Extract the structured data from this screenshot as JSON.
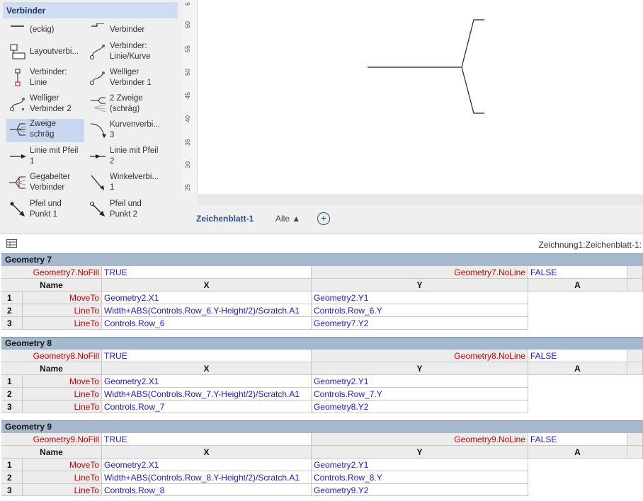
{
  "stencil": {
    "title": "Verbinder",
    "items": [
      {
        "label": "(eckig)"
      },
      {
        "label": "Verbinder"
      },
      {
        "label": "Layoutverbi..."
      },
      {
        "label": "Verbinder:\nLinie/Kurve"
      },
      {
        "label": "Verbinder:\nLinie"
      },
      {
        "label": "Welliger\nVerbinder 1"
      },
      {
        "label": "Welliger\nVerbinder 2"
      },
      {
        "label": "2 Zweige\n(schräg)"
      },
      {
        "label": "Zweige\nschräg"
      },
      {
        "label": "Kurvenverbi...\n3"
      },
      {
        "label": "Linie mit Pfeil\n1"
      },
      {
        "label": "Linie mit Pfeil\n2"
      },
      {
        "label": "Gegabelter\nVerbinder"
      },
      {
        "label": "Winkelverbi...\n1"
      },
      {
        "label": "Pfeil und\nPunkt 1"
      },
      {
        "label": "Pfeil und\nPunkt 2"
      }
    ]
  },
  "ruler": {
    "ticks": [
      "6",
      "60",
      "55",
      "50",
      "45",
      "40",
      "35",
      "30",
      "25"
    ]
  },
  "tabs": {
    "active": "Zeichenblatt-1",
    "all": "Alle ▲",
    "add": "+"
  },
  "sheet": {
    "path": "Zeichnung1:Zeichenblatt-1:",
    "col_name": "Name",
    "col_x": "X",
    "col_y": "Y",
    "col_a": "A",
    "sections": [
      {
        "title": "Geometry 7",
        "nofill_name": "Geometry7.NoFill",
        "nofill_value": "TRUE",
        "noline_name": "Geometry7.NoLine",
        "noline_value": "FALSE",
        "rows": [
          {
            "n": "1",
            "name": "MoveTo",
            "x": "Geometry2.X1",
            "y": "Geometry2.Y1"
          },
          {
            "n": "2",
            "name": "LineTo",
            "x": "Width+ABS(Controls.Row_6.Y-Height/2)/Scratch.A1",
            "y": "Controls.Row_6.Y"
          },
          {
            "n": "3",
            "name": "LineTo",
            "x": "Controls.Row_6",
            "y": "Geometry7.Y2"
          }
        ]
      },
      {
        "title": "Geometry 8",
        "nofill_name": "Geometry8.NoFill",
        "nofill_value": "TRUE",
        "noline_name": "Geometry8.NoLine",
        "noline_value": "FALSE",
        "rows": [
          {
            "n": "1",
            "name": "MoveTo",
            "x": "Geometry2.X1",
            "y": "Geometry2.Y1"
          },
          {
            "n": "2",
            "name": "LineTo",
            "x": "Width+ABS(Controls.Row_7.Y-Height/2)/Scratch.A1",
            "y": "Controls.Row_7.Y"
          },
          {
            "n": "3",
            "name": "LineTo",
            "x": "Controls.Row_7",
            "y": "Geometry8.Y2"
          }
        ]
      },
      {
        "title": "Geometry 9",
        "nofill_name": "Geometry9.NoFill",
        "nofill_value": "TRUE",
        "noline_name": "Geometry9.NoLine",
        "noline_value": "FALSE",
        "rows": [
          {
            "n": "1",
            "name": "MoveTo",
            "x": "Geometry2.X1",
            "y": "Geometry2.Y1"
          },
          {
            "n": "2",
            "name": "LineTo",
            "x": "Width+ABS(Controls.Row_8.Y-Height/2)/Scratch.A1",
            "y": "Controls.Row_8.Y"
          },
          {
            "n": "3",
            "name": "LineTo",
            "x": "Controls.Row_8",
            "y": "Geometry9.Y2"
          }
        ]
      }
    ]
  },
  "colors": {
    "accent": "#2b4f8a",
    "formula_name": "#d00000",
    "formula_value": "#1a1ad6",
    "section_header": "#a5b8cc",
    "selected": "#c9d6f0"
  }
}
